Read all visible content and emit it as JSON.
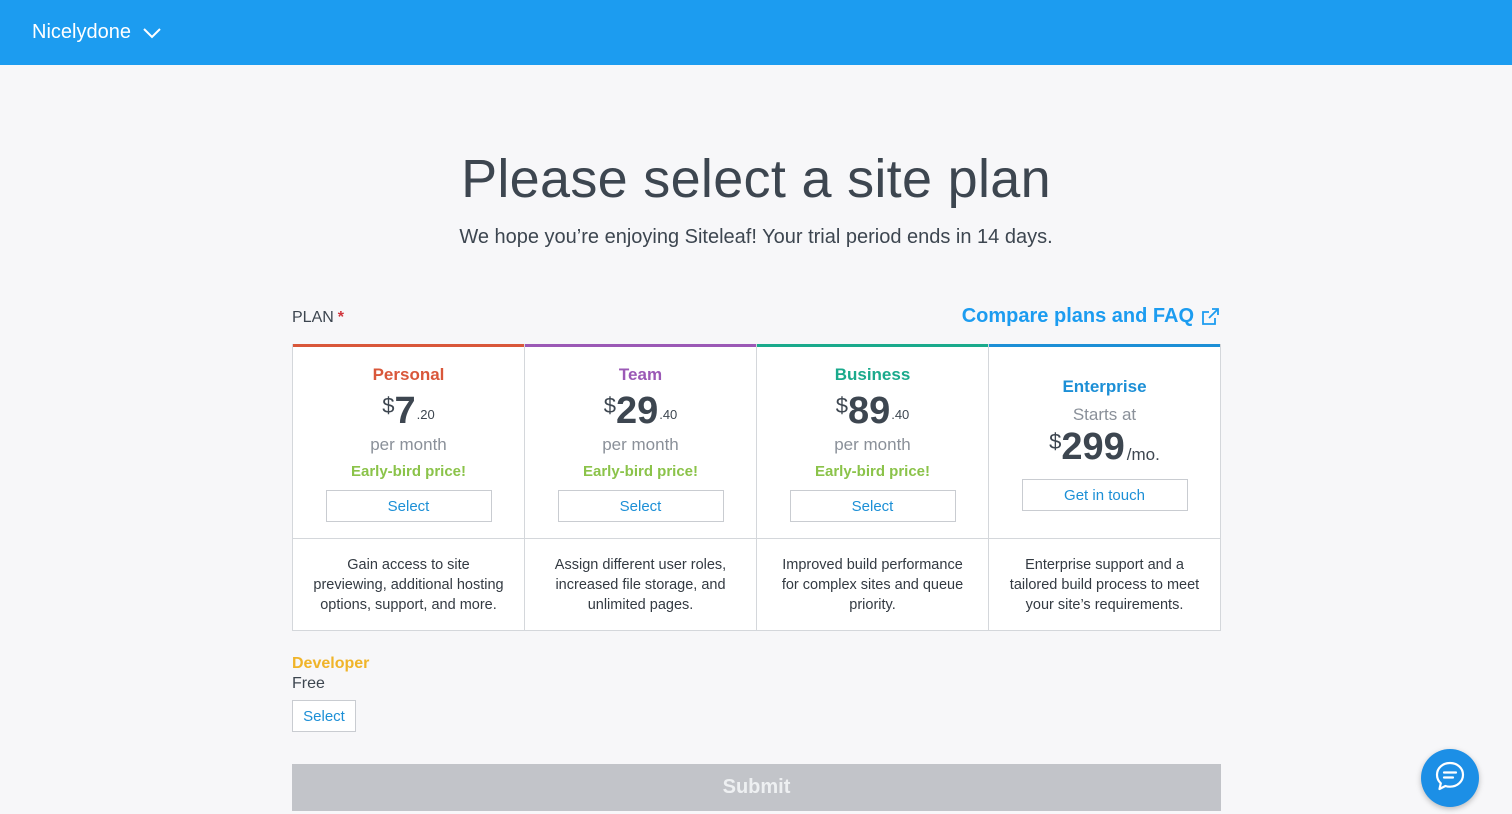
{
  "topbar": {
    "site_name": "Nicelydone",
    "chevron_icon": "chevron-down-icon"
  },
  "page": {
    "title": "Please select a site plan",
    "subtitle": "We hope you’re enjoying Siteleaf! Your trial period ends in 14 days."
  },
  "plan_field": {
    "label": "PLAN",
    "required_mark": "*",
    "compare_link": "Compare plans and FAQ",
    "compare_icon": "external-link-icon"
  },
  "plans": [
    {
      "name": "Personal",
      "color": "#d9573a",
      "currency": "$",
      "whole": "7",
      "cents": ".20",
      "per": "per month",
      "note": "Early-bird price!",
      "button": "Select",
      "description": "Gain access to site previewing, additional hosting options, support, and more."
    },
    {
      "name": "Team",
      "color": "#9b59b6",
      "currency": "$",
      "whole": "29",
      "cents": ".40",
      "per": "per month",
      "note": "Early-bird price!",
      "button": "Select",
      "description": "Assign different user roles, increased file storage, and unlimited pages."
    },
    {
      "name": "Business",
      "color": "#1aaa8c",
      "currency": "$",
      "whole": "89",
      "cents": ".40",
      "per": "per month",
      "note": "Early-bird price!",
      "button": "Select",
      "description": "Improved build performance for complex sites and queue priority."
    },
    {
      "name": "Enterprise",
      "color": "#1c8fd6",
      "starts_at": "Starts at",
      "currency": "$",
      "whole": "299",
      "suffix": "/mo.",
      "button": "Get in touch",
      "description": "Enterprise support and a tailored build process to meet your site’s requirements."
    }
  ],
  "developer": {
    "name": "Developer",
    "color": "#f0b429",
    "price": "Free",
    "button": "Select"
  },
  "submit": {
    "label": "Submit"
  },
  "chat": {
    "icon": "chat-bubble-icon"
  },
  "colors": {
    "topbar": "#1c9cf0",
    "link": "#1c9cf0",
    "early_bird": "#8bc34a",
    "submit_disabled": "#c2c4c9"
  }
}
